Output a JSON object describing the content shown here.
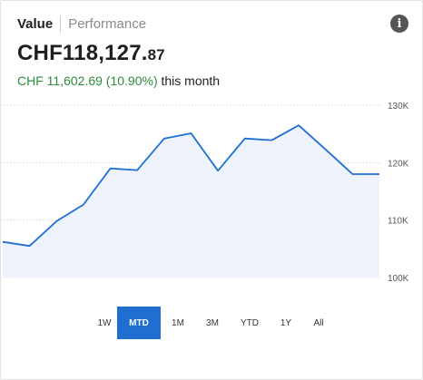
{
  "tabs": {
    "value": "Value",
    "performance": "Performance"
  },
  "info_icon": "info-icon",
  "portfolio": {
    "value_main": "CHF118,127.",
    "value_cents": "87",
    "change_amount": "CHF 11,602.69 (10.90%)",
    "change_period": "this month"
  },
  "colors": {
    "accent": "#1f6fd1",
    "positive": "#2e8b3a",
    "area": "#eef3fb"
  },
  "ranges": {
    "options": [
      "1W",
      "MTD",
      "1M",
      "3M",
      "YTD",
      "1Y",
      "All"
    ],
    "selected": "MTD"
  },
  "chart_data": {
    "type": "area",
    "y_ticks": [
      "130K",
      "120K",
      "110K",
      "100K"
    ],
    "ylim": [
      100000,
      130000
    ],
    "values": [
      106200,
      105500,
      109800,
      112700,
      119000,
      118700,
      124200,
      125100,
      118600,
      124200,
      123900,
      126500,
      122300,
      118000,
      118000
    ],
    "grid": "horizontal dotted",
    "title": "",
    "xlabel": "",
    "ylabel": ""
  }
}
